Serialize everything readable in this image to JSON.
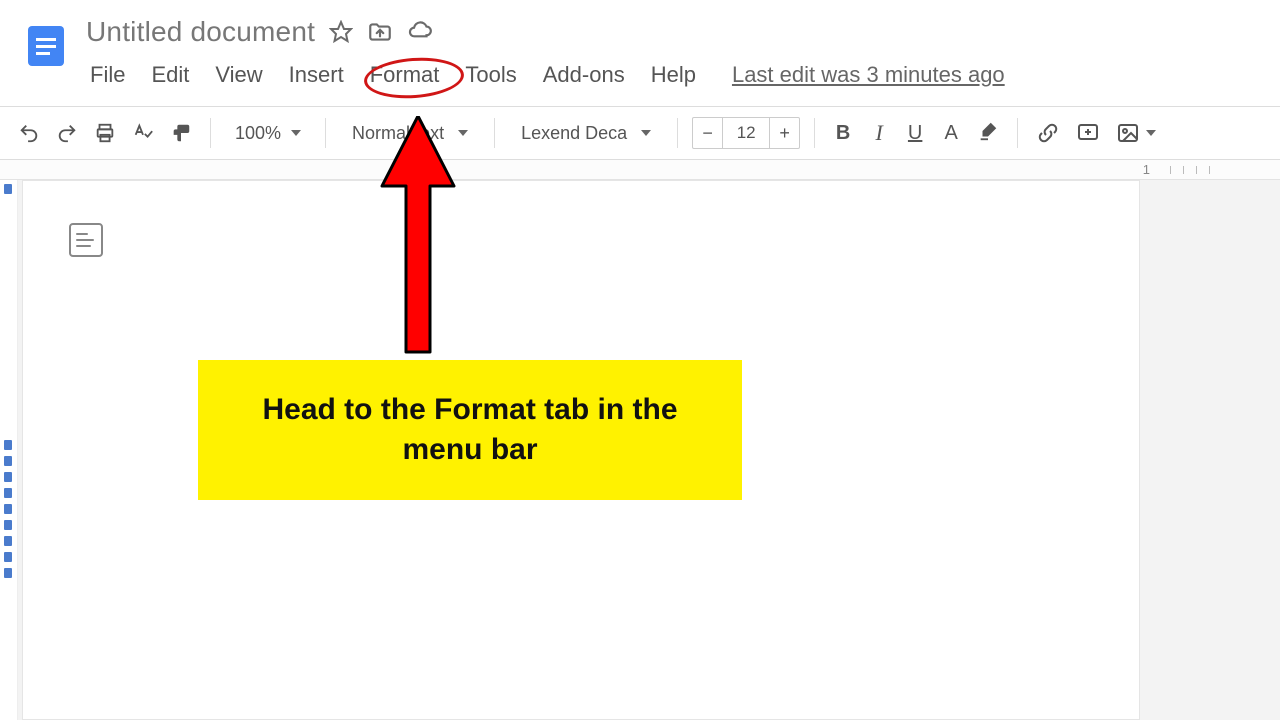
{
  "header": {
    "doc_title": "Untitled document",
    "menu": {
      "file": "File",
      "edit": "Edit",
      "view": "View",
      "insert": "Insert",
      "format": "Format",
      "tools": "Tools",
      "addons": "Add-ons",
      "help": "Help"
    },
    "last_edit": "Last edit was 3 minutes ago"
  },
  "toolbar": {
    "zoom": "100%",
    "style": "Normal text",
    "font": "Lexend Deca",
    "font_size": "12",
    "minus": "−",
    "plus": "+",
    "bold": "B",
    "italic": "I",
    "underline": "U",
    "textcolor": "A"
  },
  "ruler": {
    "mark": "1"
  },
  "annotation": {
    "callout": "Head to the Format tab in the menu bar"
  },
  "colors": {
    "accent_red": "#ff0000",
    "annot_yellow": "#fff200",
    "docs_blue": "#4285f4"
  }
}
